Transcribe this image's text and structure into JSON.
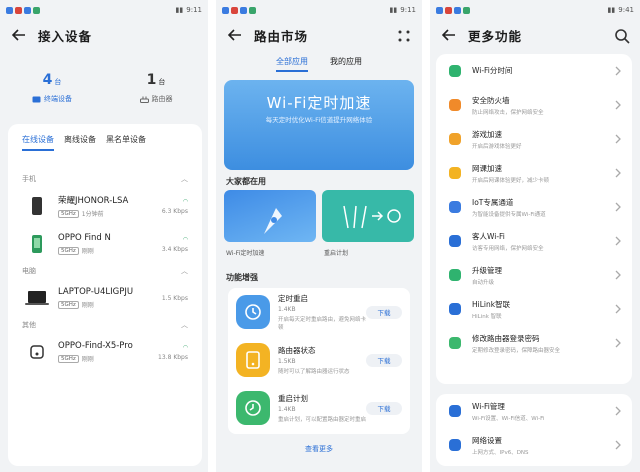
{
  "screen1": {
    "status_time": "9:11",
    "title": "接入设备",
    "stats": [
      {
        "count": "4",
        "unit": "台",
        "label": "终端设备",
        "icon": "terminal-device-icon"
      },
      {
        "count": "1",
        "unit": "台",
        "label": "路由器",
        "icon": "router-icon"
      }
    ],
    "tabs": [
      "在线设备",
      "离线设备",
      "黑名单设备"
    ],
    "active_tab": "在线设备",
    "groups": [
      {
        "name": "手机",
        "devices": [
          {
            "name": "荣耀JHONOR-LSA",
            "band": "5GHz",
            "desc": "1分钟前",
            "speed": "6.3 Kbps",
            "icon": "phone-icon"
          },
          {
            "name": "OPPO Find N",
            "band": "5GHz",
            "desc": "刚刚",
            "speed": "3.4 Kbps",
            "icon": "phone-icon"
          }
        ]
      },
      {
        "name": "电脑",
        "devices": [
          {
            "name": "LAPTOP-U4LIGPJU",
            "band": "5GHz",
            "desc": "刚刚",
            "speed": "1.5 Kbps",
            "icon": "laptop-icon"
          }
        ]
      },
      {
        "name": "其他",
        "devices": [
          {
            "name": "OPPO-Find-X5-Pro",
            "band": "5GHz",
            "desc": "刚刚",
            "speed": "13.8 Kbps",
            "icon": "device-icon"
          }
        ]
      }
    ]
  },
  "screen2": {
    "status_time": "9:11",
    "title": "路由市场",
    "tabs": [
      "全部应用",
      "我的应用"
    ],
    "banner_title": "Wi-Fi定时加速",
    "banner_sub": "每天定时优化Wi-Fi信道提升网络体验",
    "section1": "大家都在用",
    "tiles": [
      "Wi-Fi定时加速",
      "重启计划"
    ],
    "section2": "功能增强",
    "features": [
      {
        "name": "定时重启",
        "size": "1.4KB",
        "desc": "开启每天定时重启路由，避免网络卡顿",
        "btn": "下载",
        "color": "#4a9ae8"
      },
      {
        "name": "路由器状态",
        "size": "1.5KB",
        "desc": "随时可以了解路由器运行状态",
        "btn": "下载",
        "color": "#f3b323"
      },
      {
        "name": "重启计划",
        "size": "1.4KB",
        "desc": "重启计划，可以配置路由器定时重启",
        "btn": "下载",
        "color": "#3cb86e"
      }
    ],
    "more": "查看更多"
  },
  "screen3": {
    "status_time": "9:41",
    "title": "更多功能",
    "items": [
      {
        "name": "Wi-Fi分时间",
        "desc": "",
        "icon": "wifi-timer-icon",
        "color": "#2fb36f"
      },
      {
        "name": "安全防火墙",
        "desc": "防止网络攻击，保护网络安全",
        "icon": "firewall-icon",
        "color": "#f08a2a"
      },
      {
        "name": "游戏加速",
        "desc": "开启后游戏体验更好",
        "icon": "game-icon",
        "color": "#f0a22a"
      },
      {
        "name": "网课加速",
        "desc": "开启后网课体验更好，减少卡顿",
        "icon": "class-icon",
        "color": "#f3b323"
      },
      {
        "name": "IoT专属通道",
        "desc": "为智能设备提供专属Wi-Fi通道",
        "icon": "iot-icon",
        "color": "#3a7be0"
      },
      {
        "name": "客人Wi-Fi",
        "desc": "访客专用网络，保护网络安全",
        "icon": "guest-wifi-icon",
        "color": "#2a6fd6"
      },
      {
        "name": "升级管理",
        "desc": "自动升级",
        "icon": "upgrade-icon",
        "color": "#2fb36f"
      },
      {
        "name": "HiLink智联",
        "desc": "HiLink 智联",
        "icon": "hilink-icon",
        "color": "#2a6fd6"
      },
      {
        "name": "修改路由器登录密码",
        "desc": "定期修改登录密码，保障路由器安全",
        "icon": "password-icon",
        "color": "#3cb86e"
      }
    ],
    "items2": [
      {
        "name": "Wi-Fi管理",
        "desc": "Wi-Fi设置、Wi-Fi信道、Wi-Fi",
        "icon": "wifi-icon",
        "color": "#2a6fd6"
      },
      {
        "name": "网络设置",
        "desc": "上网方式、IPv6、DNS",
        "icon": "network-settings-icon",
        "color": "#2a6fd6"
      }
    ]
  }
}
